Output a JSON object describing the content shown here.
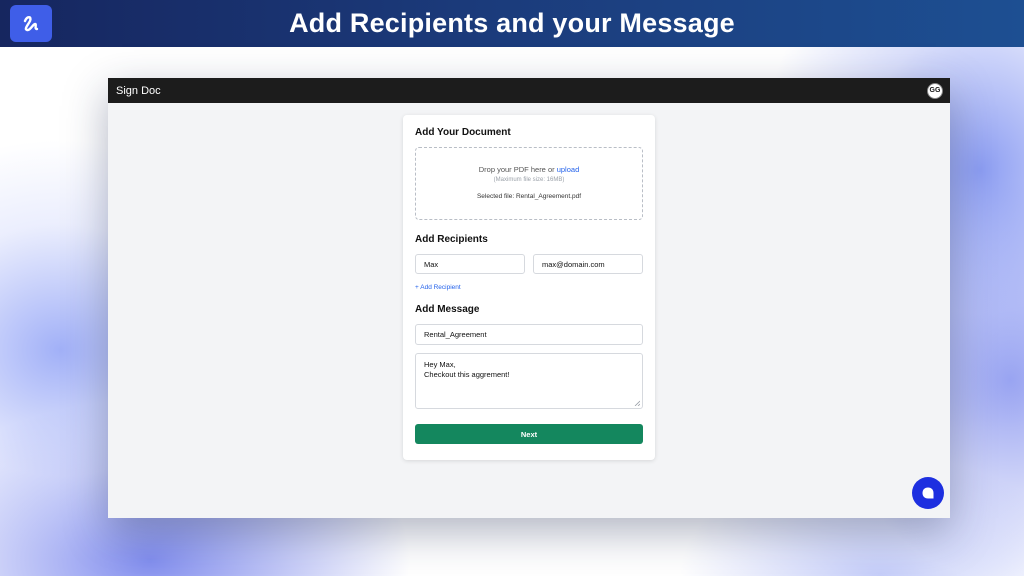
{
  "banner": {
    "title": "Add Recipients and your Message",
    "logo_icon": "signature-icon"
  },
  "app": {
    "title": "Sign Doc",
    "avatar_initials": "GG"
  },
  "document": {
    "heading": "Add Your Document",
    "drop_text": "Drop your PDF here or",
    "upload_link": "upload",
    "size_note": "(Maximum file size: 16MB)",
    "selected_file": "Selected file: Rental_Agreement.pdf"
  },
  "recipients": {
    "heading": "Add Recipients",
    "name": "Max",
    "email": "max@domain.com",
    "add_link": "+ Add Recipient"
  },
  "message": {
    "heading": "Add Message",
    "subject": "Rental_Agreement",
    "body_line1": "Hey Max,",
    "body_line2": "Checkout this aggrement!"
  },
  "actions": {
    "next_label": "Next"
  },
  "colors": {
    "primary_button": "#14875e",
    "link": "#2563eb",
    "chat_bubble": "#1d2fe0",
    "banner_logo": "#3f5ee8"
  },
  "icons": {
    "chat": "chat-icon",
    "resize": "resize-handle-icon"
  }
}
